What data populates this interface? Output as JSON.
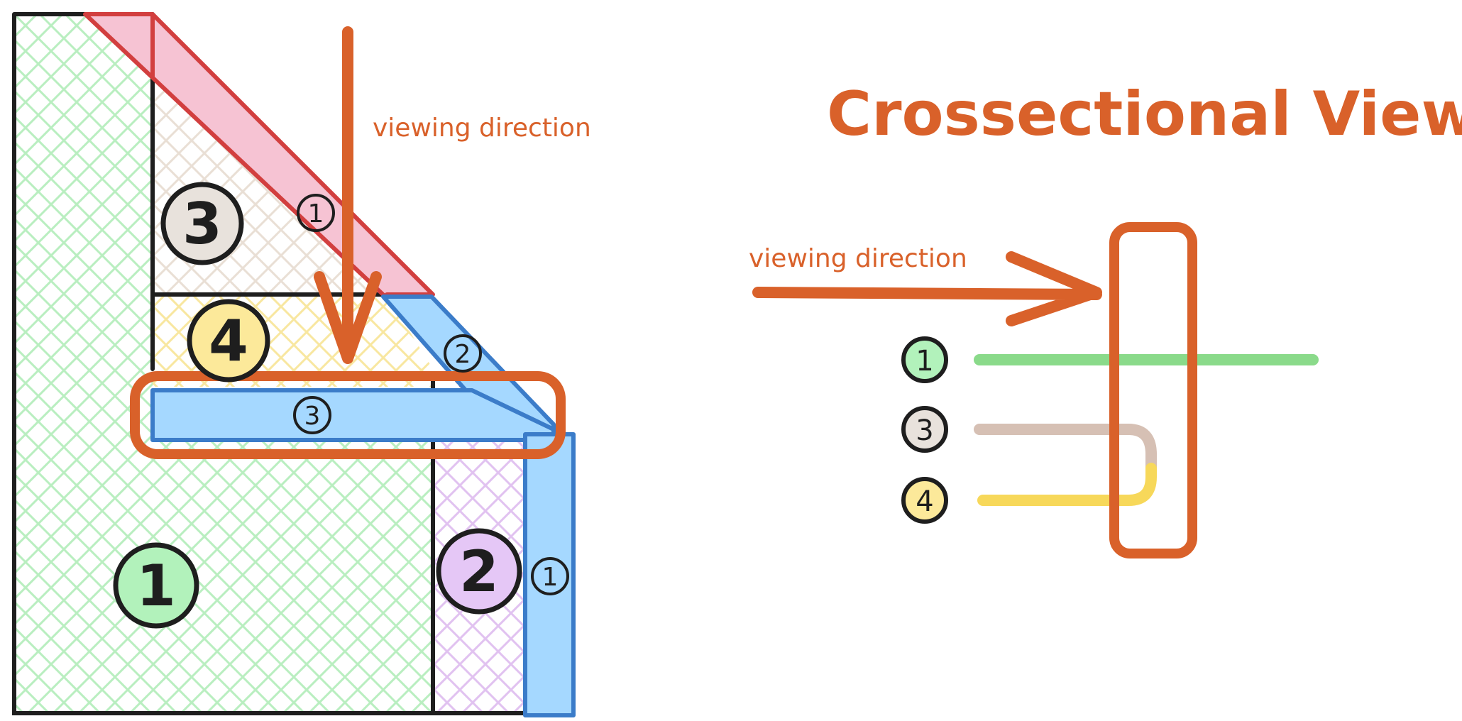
{
  "title": "Crossectional View",
  "left_diagram": {
    "viewing_direction_label": "viewing direction",
    "region_numbers": [
      "1",
      "2",
      "3",
      "4"
    ],
    "strip_numbers": {
      "pink_strip": "1",
      "blue_diagonal": "2",
      "blue_horizontal": "3",
      "blue_vertical": "1"
    }
  },
  "right_diagram": {
    "viewing_direction_label": "viewing direction",
    "layers": [
      {
        "number": "1"
      },
      {
        "number": "3"
      },
      {
        "number": "4"
      }
    ]
  },
  "colors": {
    "orange": "#d9612a",
    "green": "#b2f2bb",
    "green_line": "#8ada8a",
    "purple": "#e5c7f6",
    "beige": "#e8e2dc",
    "beige_line": "#d6c0b4",
    "yellow": "#fce99a",
    "yellow_line": "#f7d85a",
    "pink": "#f6c3d3",
    "red": "#d23f3f",
    "blue": "#a5d8ff",
    "blue_stroke": "#3b7cc9",
    "black": "#1e1e1e"
  }
}
